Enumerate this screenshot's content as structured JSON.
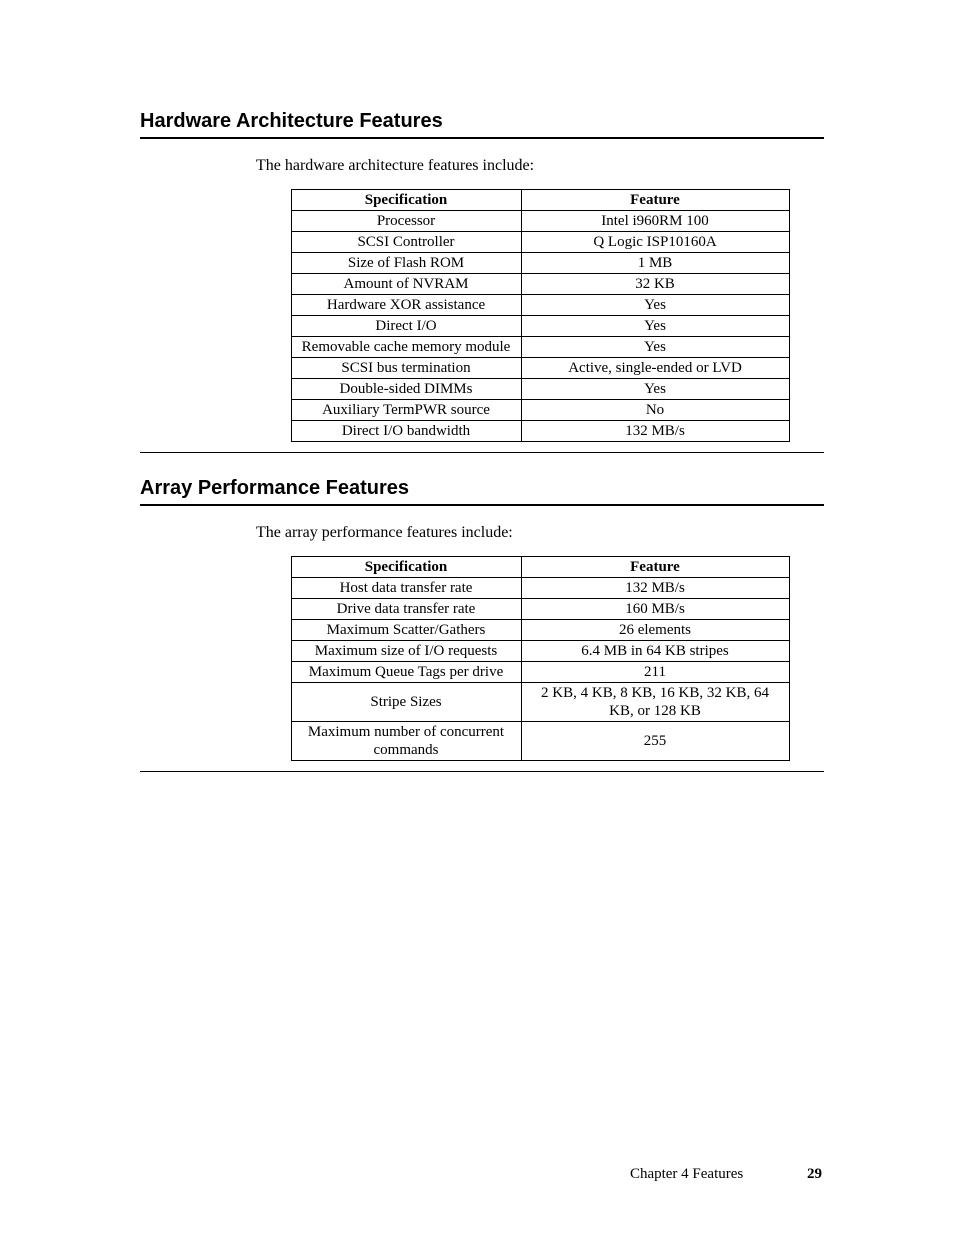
{
  "section1": {
    "heading": "Hardware Architecture Features",
    "intro": "The hardware architecture features include:",
    "headers": {
      "c1": "Specification",
      "c2": "Feature"
    },
    "rows": [
      {
        "spec": "Processor",
        "feat": "Intel i960RM 100"
      },
      {
        "spec": "SCSI Controller",
        "feat": "Q Logic ISP10160A"
      },
      {
        "spec": "Size of Flash ROM",
        "feat": "1 MB"
      },
      {
        "spec": "Amount of NVRAM",
        "feat": "32 KB"
      },
      {
        "spec": "Hardware XOR assistance",
        "feat": "Yes"
      },
      {
        "spec": "Direct I/O",
        "feat": "Yes"
      },
      {
        "spec": "Removable cache memory module",
        "feat": "Yes"
      },
      {
        "spec": "SCSI bus termination",
        "feat": "Active, single-ended or LVD"
      },
      {
        "spec": "Double-sided DIMMs",
        "feat": "Yes"
      },
      {
        "spec": "Auxiliary TermPWR source",
        "feat": "No"
      },
      {
        "spec": "Direct I/O bandwidth",
        "feat": "132 MB/s"
      }
    ]
  },
  "section2": {
    "heading": "Array Performance Features",
    "intro": "The array performance features include:",
    "headers": {
      "c1": "Specification",
      "c2": "Feature"
    },
    "rows": [
      {
        "spec": "Host data transfer rate",
        "feat": "132 MB/s"
      },
      {
        "spec": "Drive data transfer rate",
        "feat": "160 MB/s"
      },
      {
        "spec": "Maximum Scatter/Gathers",
        "feat": "26 elements"
      },
      {
        "spec": "Maximum size of I/O requests",
        "feat": "6.4 MB in 64 KB stripes"
      },
      {
        "spec": "Maximum Queue Tags per drive",
        "feat": "211"
      },
      {
        "spec": "Stripe Sizes",
        "feat": "2 KB, 4 KB, 8 KB, 16 KB, 32 KB, 64 KB, or 128 KB"
      },
      {
        "spec": "Maximum number of concurrent commands",
        "feat": "255"
      }
    ]
  },
  "footer": {
    "chapter": "Chapter 4 Features",
    "page": "29"
  }
}
